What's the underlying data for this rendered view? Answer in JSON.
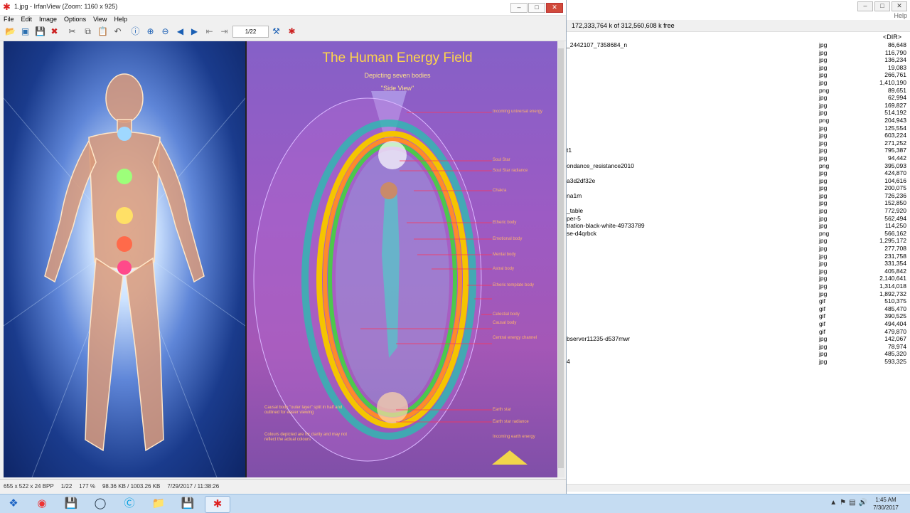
{
  "file_manager": {
    "help": "Help",
    "status": "172,333,764 k of 312,560,608 k free",
    "header_size": "<DIR>",
    "rows": [
      {
        "name": "_2442107_7358684_n",
        "ext": "jpg",
        "size": "86,648"
      },
      {
        "name": "",
        "ext": "jpg",
        "size": "116,790"
      },
      {
        "name": "",
        "ext": "jpg",
        "size": "136,234"
      },
      {
        "name": "",
        "ext": "jpg",
        "size": "19,083"
      },
      {
        "name": "",
        "ext": "jpg",
        "size": "266,761"
      },
      {
        "name": "",
        "ext": "jpg",
        "size": "1,410,190"
      },
      {
        "name": "",
        "ext": "png",
        "size": "89,651"
      },
      {
        "name": "",
        "ext": "jpg",
        "size": "62,994"
      },
      {
        "name": "",
        "ext": "jpg",
        "size": "169,827"
      },
      {
        "name": "",
        "ext": "jpg",
        "size": "514,192"
      },
      {
        "name": "",
        "ext": "png",
        "size": "204,943"
      },
      {
        "name": "",
        "ext": "jpg",
        "size": "125,554"
      },
      {
        "name": "",
        "ext": "jpg",
        "size": "603,224"
      },
      {
        "name": "",
        "ext": "jpg",
        "size": "271,252"
      },
      {
        "name": "t1",
        "ext": "jpg",
        "size": "795,387"
      },
      {
        "name": "",
        "ext": "jpg",
        "size": "94,442"
      },
      {
        "name": "ondance_resistance2010",
        "ext": "png",
        "size": "395,093"
      },
      {
        "name": "",
        "ext": "jpg",
        "size": "424,870"
      },
      {
        "name": "a3d2df32e",
        "ext": "jpg",
        "size": "104,616"
      },
      {
        "name": "",
        "ext": "jpg",
        "size": "200,075"
      },
      {
        "name": "na1m",
        "ext": "jpg",
        "size": "726,236"
      },
      {
        "name": "",
        "ext": "jpg",
        "size": "152,850"
      },
      {
        "name": "_table",
        "ext": "jpg",
        "size": "772,920"
      },
      {
        "name": "per-5",
        "ext": "jpg",
        "size": "562,494"
      },
      {
        "name": "tration-black-white-49733789",
        "ext": "jpg",
        "size": "114,250"
      },
      {
        "name": "se-d4qrbck",
        "ext": "png",
        "size": "566,162"
      },
      {
        "name": "",
        "ext": "jpg",
        "size": "1,295,172"
      },
      {
        "name": "",
        "ext": "jpg",
        "size": "277,708"
      },
      {
        "name": "",
        "ext": "jpg",
        "size": "231,758"
      },
      {
        "name": "",
        "ext": "jpg",
        "size": "331,354"
      },
      {
        "name": "",
        "ext": "jpg",
        "size": "405,842"
      },
      {
        "name": "",
        "ext": "jpg",
        "size": "2,140,641"
      },
      {
        "name": "",
        "ext": "jpg",
        "size": "1,314,018"
      },
      {
        "name": "",
        "ext": "jpg",
        "size": "1,892,732"
      },
      {
        "name": "",
        "ext": "gif",
        "size": "510,375"
      },
      {
        "name": "",
        "ext": "gif",
        "size": "485,470"
      },
      {
        "name": "",
        "ext": "gif",
        "size": "390,525"
      },
      {
        "name": "",
        "ext": "gif",
        "size": "494,404"
      },
      {
        "name": "",
        "ext": "gif",
        "size": "479,870"
      },
      {
        "name": "bserver11235-d537mwr",
        "ext": "jpg",
        "size": "142,067"
      },
      {
        "name": "",
        "ext": "jpg",
        "size": "78,974"
      },
      {
        "name": "",
        "ext": "jpg",
        "size": "485,320"
      },
      {
        "name": "4",
        "ext": "jpg",
        "size": "593,325"
      }
    ]
  },
  "irfanview": {
    "title": "1.jpg - IrfanView (Zoom: 1160 x 925)",
    "menu": [
      "File",
      "Edit",
      "Image",
      "Options",
      "View",
      "Help"
    ],
    "page_counter": "1/22",
    "status": [
      "655 x 522 x 24 BPP",
      "1/22",
      "177 %",
      "98.36 KB / 1003.26 KB",
      "7/29/2017 / 11:38:26"
    ],
    "image": {
      "title": "The Human Energy Field",
      "subtitle": "Depicting seven bodies",
      "subtitle2": "\"Side View\"",
      "labels": [
        "Incoming universal energy",
        "Soul Star",
        "Soul Star radiance",
        "Chakra",
        "Etheric body",
        "Emotional body",
        "Mental body",
        "Astral body",
        "Etheric template body",
        "Celestial body",
        "Causal body",
        "Central energy channel",
        "Earth star",
        "Earth star radiance",
        "Incoming earth energy"
      ],
      "note1": "Causal body \"outer layer\" split in half and outlined for easier viewing",
      "note2": "Colours depicted are for clarity and may not reflect the actual colours"
    }
  },
  "taskbar": {
    "time": "1:45 AM",
    "date": "7/30/2017"
  },
  "colors": {
    "irfan_close": "#d14a3b",
    "title_yellow": "#ffd54a",
    "taskbar": "#c5dcf2"
  }
}
